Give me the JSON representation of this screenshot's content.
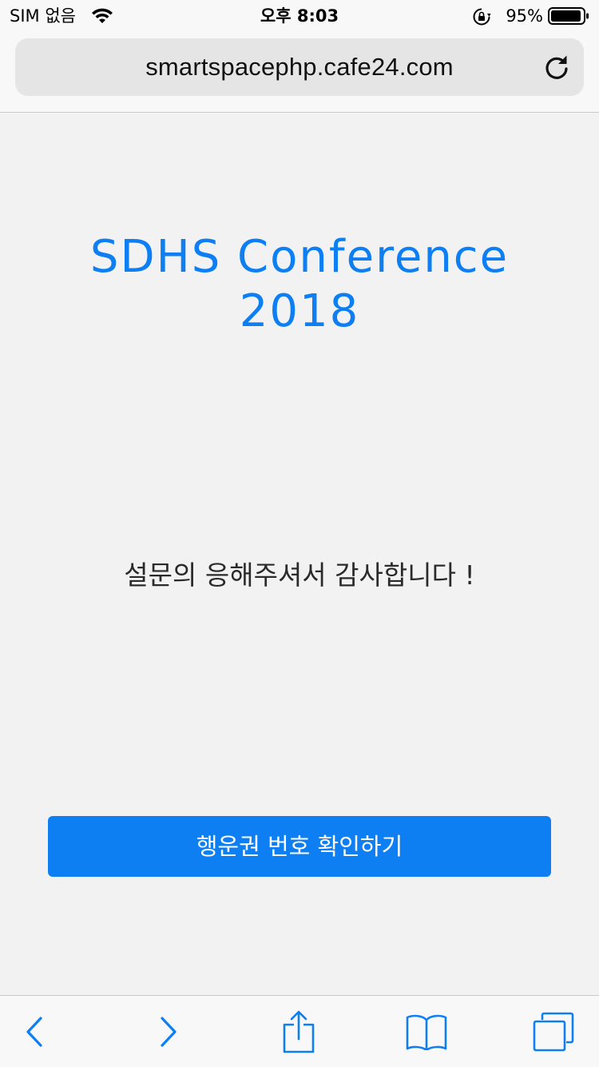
{
  "status_bar": {
    "carrier": "SIM 없음",
    "time": "오후 8:03",
    "battery_percent": "95%",
    "battery_level": 0.95,
    "icons": [
      "wifi-icon",
      "orientation-lock-icon",
      "battery-icon"
    ]
  },
  "browser": {
    "url": "smartspacephp.cafe24.com",
    "reload_icon": "reload-icon",
    "toolbar_icons": [
      "back-icon",
      "forward-icon",
      "share-icon",
      "bookmarks-icon",
      "tabs-icon"
    ]
  },
  "page": {
    "title_line1": "SDHS Conference",
    "title_line2": "2018",
    "message": "설문의 응해주셔서 감사합니다 !",
    "button_label": "행운권 번호 확인하기"
  },
  "colors": {
    "accent": "#0d7ff2",
    "page_background": "#f2f2f2",
    "bar_background": "#f8f8f8",
    "address_field": "#e5e5e6"
  }
}
